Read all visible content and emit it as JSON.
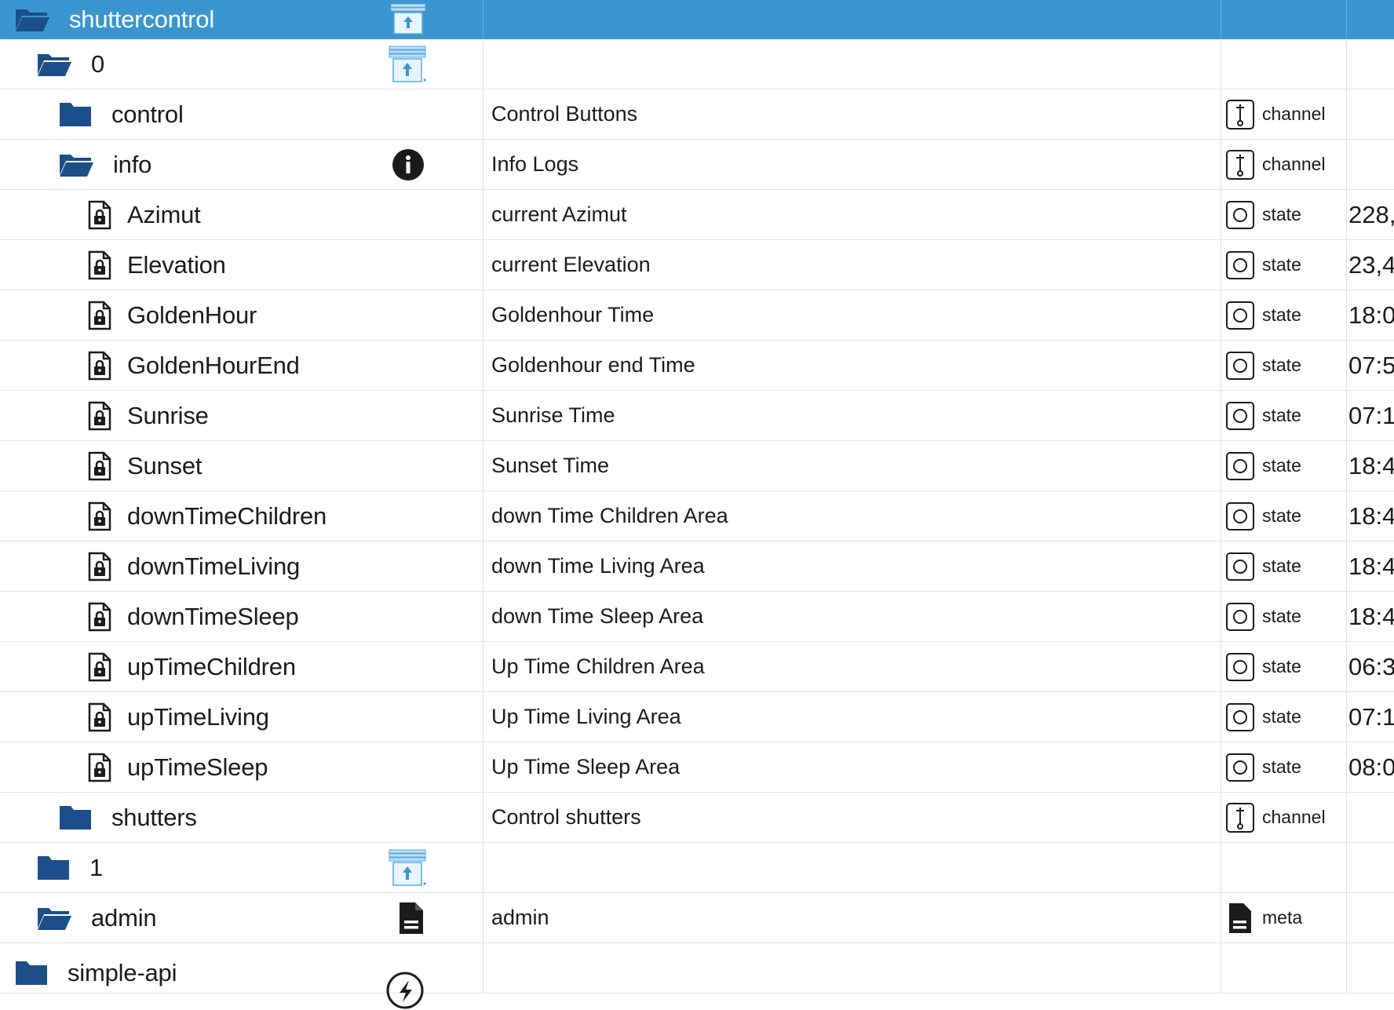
{
  "colors": {
    "header_bg": "#3a96d0",
    "folder": "#1c4f8a",
    "icon_dark": "#1b1b1b"
  },
  "header": {
    "name": "shuttercontrol",
    "icon": "folder-open-icon",
    "action_icon": "shutter-upload-icon"
  },
  "rows": [
    {
      "name": "0",
      "depth": 1,
      "kind": "folder-open",
      "action": "shutter",
      "description": "",
      "type": "",
      "value": ""
    },
    {
      "name": "control",
      "depth": 2,
      "kind": "folder",
      "action": "",
      "description": "Control Buttons",
      "type": "channel",
      "value": ""
    },
    {
      "name": "info",
      "depth": 2,
      "kind": "folder-open",
      "action": "info",
      "description": "Info Logs",
      "type": "channel",
      "value": ""
    },
    {
      "name": "Azimut",
      "depth": 3,
      "kind": "file",
      "action": "",
      "description": "current Azimut",
      "type": "state",
      "value": "228,"
    },
    {
      "name": "Elevation",
      "depth": 3,
      "kind": "file",
      "action": "",
      "description": "current Elevation",
      "type": "state",
      "value": "23,4"
    },
    {
      "name": "GoldenHour",
      "depth": 3,
      "kind": "file",
      "action": "",
      "description": "Goldenhour Time",
      "type": "state",
      "value": "18:0"
    },
    {
      "name": "GoldenHourEnd",
      "depth": 3,
      "kind": "file",
      "action": "",
      "description": "Goldenhour end Time",
      "type": "state",
      "value": "07:5"
    },
    {
      "name": "Sunrise",
      "depth": 3,
      "kind": "file",
      "action": "",
      "description": "Sunrise Time",
      "type": "state",
      "value": "07:1"
    },
    {
      "name": "Sunset",
      "depth": 3,
      "kind": "file",
      "action": "",
      "description": "Sunset Time",
      "type": "state",
      "value": "18:4"
    },
    {
      "name": "downTimeChildren",
      "depth": 3,
      "kind": "file",
      "action": "",
      "description": "down Time Children Area",
      "type": "state",
      "value": "18:4"
    },
    {
      "name": "downTimeLiving",
      "depth": 3,
      "kind": "file",
      "action": "",
      "description": "down Time Living Area",
      "type": "state",
      "value": "18:4"
    },
    {
      "name": "downTimeSleep",
      "depth": 3,
      "kind": "file",
      "action": "",
      "description": "down Time Sleep Area",
      "type": "state",
      "value": "18:4"
    },
    {
      "name": "upTimeChildren",
      "depth": 3,
      "kind": "file",
      "action": "",
      "description": "Up Time Children Area",
      "type": "state",
      "value": "06:3"
    },
    {
      "name": "upTimeLiving",
      "depth": 3,
      "kind": "file",
      "action": "",
      "description": "Up Time Living Area",
      "type": "state",
      "value": "07:1"
    },
    {
      "name": "upTimeSleep",
      "depth": 3,
      "kind": "file",
      "action": "",
      "description": "Up Time Sleep Area",
      "type": "state",
      "value": "08:0"
    },
    {
      "name": "shutters",
      "depth": 2,
      "kind": "folder",
      "action": "",
      "description": "Control shutters",
      "type": "channel",
      "value": ""
    },
    {
      "name": "1",
      "depth": 1,
      "kind": "folder",
      "action": "shutter",
      "description": "",
      "type": "",
      "value": ""
    },
    {
      "name": "admin",
      "depth": 1,
      "kind": "folder-open",
      "action": "doc",
      "description": "admin",
      "type": "meta",
      "value": ""
    },
    {
      "name": "simple-api",
      "depth": 0,
      "kind": "folder",
      "action": "api",
      "description": "",
      "type": "",
      "value": ""
    }
  ]
}
